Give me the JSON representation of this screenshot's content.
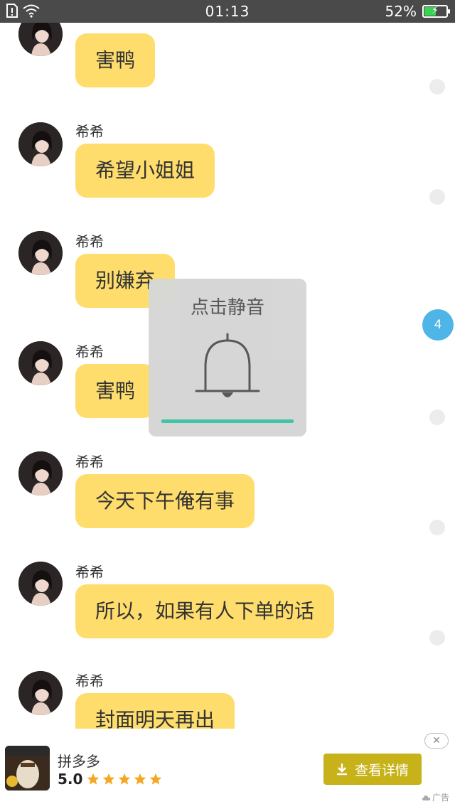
{
  "status_bar": {
    "time": "01:13",
    "battery_percent": "52%",
    "battery_level": 0.52,
    "icons": [
      "sim-alert-icon",
      "wifi-icon",
      "battery-charging-icon"
    ]
  },
  "messages": [
    {
      "sender": "",
      "text": "害鸭"
    },
    {
      "sender": "希希",
      "text": "希望小姐姐"
    },
    {
      "sender": "希希",
      "text": "别嫌弃"
    },
    {
      "sender": "希希",
      "text": "害鸭"
    },
    {
      "sender": "希希",
      "text": "今天下午俺有事"
    },
    {
      "sender": "希希",
      "text": "所以，如果有人下单的话"
    },
    {
      "sender": "希希",
      "text": "封面明天再出"
    }
  ],
  "unread_badge": "4",
  "mute_popup": {
    "title": "点击静音",
    "icon": "bell-icon",
    "progress": 1.0
  },
  "ad": {
    "app_name": "拼多多",
    "rating": "5.0",
    "stars": 5,
    "button_label": "查看详情",
    "close_label": "✕",
    "ad_label": "广告",
    "colors": {
      "button": "#c7b21a",
      "star": "#f5a623"
    }
  },
  "colors": {
    "bubble": "#fedd6d",
    "status_bar": "#4a4a4a",
    "badge": "#4fb5e6",
    "progress": "#3ec4a6"
  }
}
